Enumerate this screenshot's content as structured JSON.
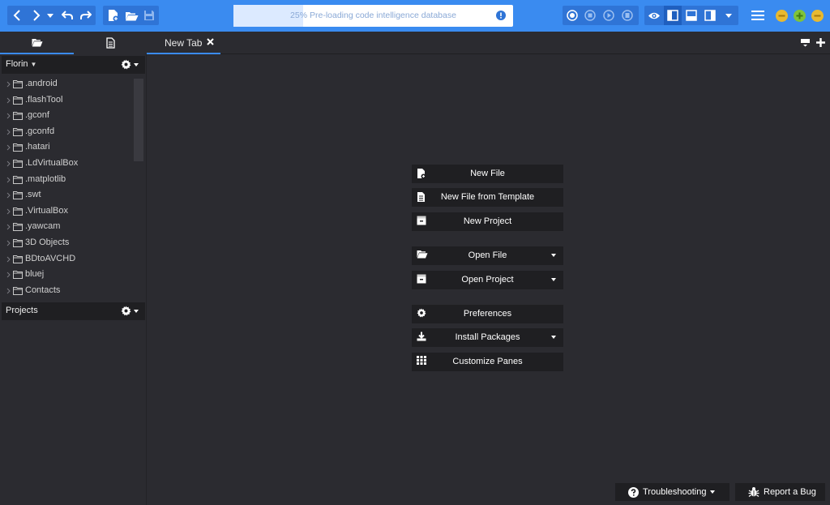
{
  "toolbar": {
    "progress_text": "25% Pre-loading code intelligence database",
    "progress_value": 0.25
  },
  "left_panel": {
    "places_title": "Florin",
    "files": [
      ".android",
      ".flashTool",
      ".gconf",
      ".gconfd",
      ".hatari",
      ".LdVirtualBox",
      ".matplotlib",
      ".swt",
      ".VirtualBox",
      ".yawcam",
      "3D Objects",
      "BDtoAVCHD",
      "bluej",
      "Contacts"
    ],
    "projects_title": "Projects"
  },
  "tabs": [
    {
      "label": "New Tab",
      "close": "✕"
    }
  ],
  "quick_start": {
    "new_file": "New File",
    "new_from_template": "New File from Template",
    "new_project": "New Project",
    "open_file": "Open File",
    "open_project": "Open Project",
    "preferences": "Preferences",
    "install_packages": "Install Packages",
    "customize_panes": "Customize Panes"
  },
  "bottom": {
    "troubleshooting": "Troubleshooting",
    "report_bug": "Report a Bug"
  },
  "colors": {
    "accent": "#3a8bf0",
    "background": "#2b2b30",
    "button": "#1f1f22",
    "minimize": "#e8b930",
    "maximize": "#7fc33a"
  }
}
